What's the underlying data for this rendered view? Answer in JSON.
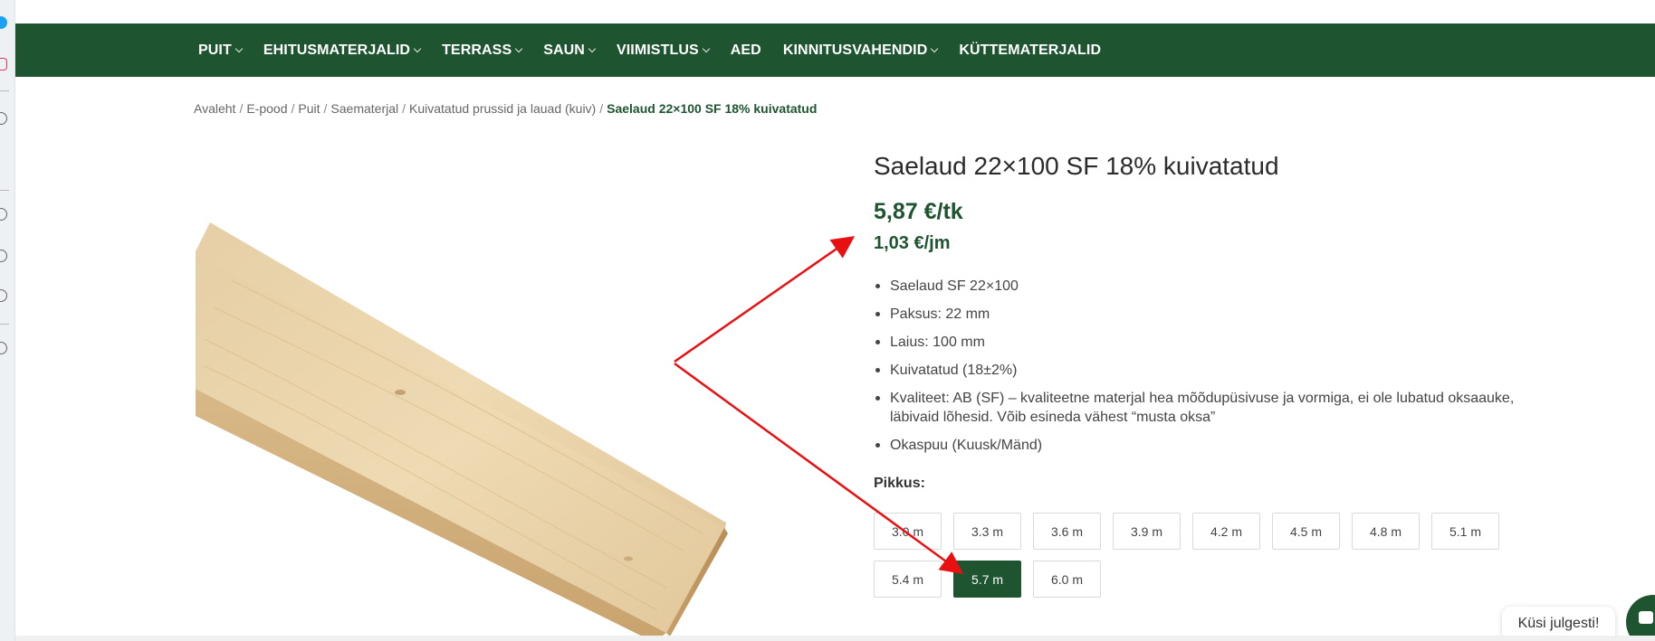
{
  "nav": {
    "items": [
      {
        "label": "PUIT",
        "dropdown": true
      },
      {
        "label": "EHITUSMATERJALID",
        "dropdown": true
      },
      {
        "label": "TERRASS",
        "dropdown": true
      },
      {
        "label": "SAUN",
        "dropdown": true
      },
      {
        "label": "VIIMISTLUS",
        "dropdown": true
      },
      {
        "label": "AED",
        "dropdown": false
      },
      {
        "label": "KINNITUSVAHENDID",
        "dropdown": true
      },
      {
        "label": "KÜTTEMATERJALID",
        "dropdown": false
      }
    ]
  },
  "breadcrumb": {
    "items": [
      "Avaleht",
      "E-pood",
      "Puit",
      "Saematerjal",
      "Kuivatatud prussid ja lauad (kuiv)"
    ],
    "separator": "/",
    "current": "Saelaud 22×100 SF 18% kuivatatud"
  },
  "product": {
    "title": "Saelaud 22×100 SF 18% kuivatatud",
    "price_main": "5,87 €/tk",
    "price_sub": "1,03 €/jm",
    "features": [
      "Saelaud SF 22×100",
      "Paksus: 22 mm",
      "Laius: 100 mm",
      "Kuivatatud (18±2%)",
      "Kvaliteet: AB (SF) – kvaliteetne materjal hea mõõdupüsivuse ja vormiga, ei ole lubatud oksaauke, läbivaid lõhesid. Võib esineda vähest “musta oksa”",
      "Okaspuu (Kuusk/Mänd)"
    ],
    "variation_label": "Pikkus",
    "variation_colon": ":",
    "lengths": [
      "3.0 m",
      "3.3 m",
      "3.6 m",
      "3.9 m",
      "4.2 m",
      "4.5 m",
      "4.8 m",
      "5.1 m",
      "5.4 m",
      "5.7 m",
      "6.0 m"
    ],
    "selected_length": "5.7 m"
  },
  "chat": {
    "bubble_text": "Küsi julgesti!"
  },
  "colors": {
    "brand_green": "#1f5431",
    "annotation_red": "#e81010"
  }
}
